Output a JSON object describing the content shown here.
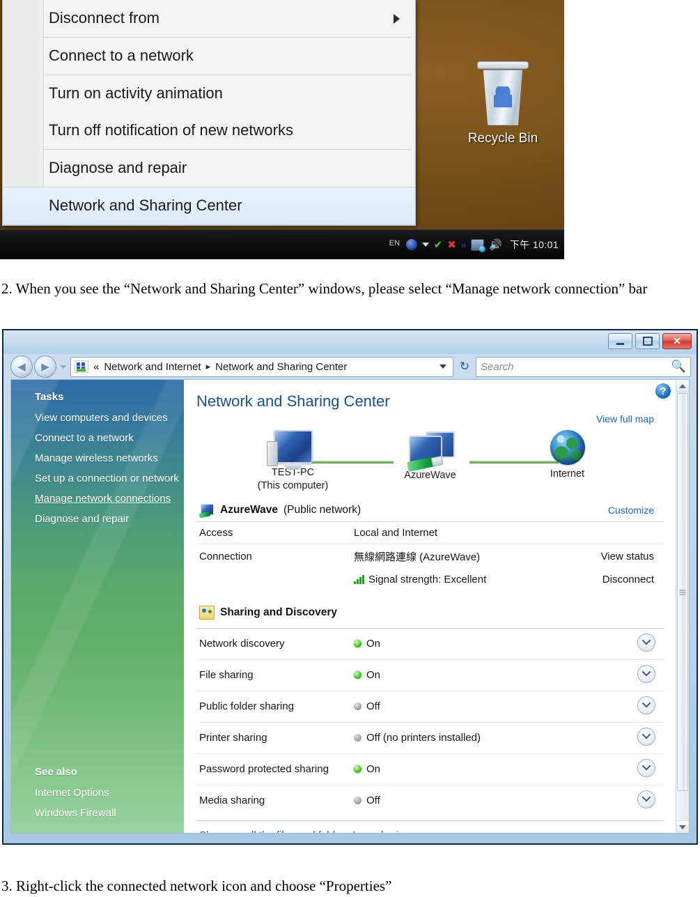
{
  "step1": {
    "context_menu": {
      "items": [
        {
          "label": "Disconnect from",
          "has_submenu": true,
          "highlighted": false
        },
        {
          "label": "Connect to a network",
          "has_submenu": false,
          "highlighted": false
        },
        {
          "label": "Turn on activity animation",
          "has_submenu": false,
          "highlighted": false
        },
        {
          "label": "Turn off notification of new networks",
          "has_submenu": false,
          "highlighted": false
        },
        {
          "label": "Diagnose and repair",
          "has_submenu": false,
          "highlighted": false
        },
        {
          "label": "Network and Sharing Center",
          "has_submenu": false,
          "highlighted": true
        }
      ]
    },
    "desktop": {
      "recycle_bin_label": "Recycle Bin"
    },
    "taskbar": {
      "language_indicator": "EN",
      "clock": "下午 10:01",
      "tray_icons": [
        "language-icon",
        "blue-orb-icon",
        "show-hidden-icons-icon",
        "green-check-icon",
        "red-shield-icon",
        "blue-wireless-icon",
        "network-icon",
        "volume-icon"
      ]
    }
  },
  "caption2": "2. When you see the “Network and Sharing Center” windows, please select “Manage network connection” bar",
  "caption3": "3. Right-click the connected network icon and choose “Properties”",
  "window": {
    "controls": {
      "minimize": "",
      "maximize": "",
      "close": "✕"
    },
    "address": {
      "icon": "network-icon",
      "overflow": "«",
      "crumbs": [
        "Network and Internet",
        "Network and Sharing Center"
      ],
      "separator": "▸"
    },
    "search": {
      "placeholder": "Search",
      "icon": "magnifier-icon"
    },
    "sidebar": {
      "tasks_heading": "Tasks",
      "tasks": [
        {
          "label": "View computers and devices",
          "active": false
        },
        {
          "label": "Connect to a network",
          "active": false
        },
        {
          "label": "Manage wireless networks",
          "active": false
        },
        {
          "label": "Set up a connection or network",
          "active": false
        },
        {
          "label": "Manage network connections",
          "active": true
        },
        {
          "label": "Diagnose and repair",
          "active": false
        }
      ],
      "see_also_heading": "See also",
      "see_also": [
        {
          "label": "Internet Options"
        },
        {
          "label": "Windows Firewall"
        }
      ]
    },
    "content": {
      "page_title": "Network and Sharing Center",
      "help_button": "?",
      "view_full_map": "View full map",
      "map": {
        "nodes": [
          {
            "name": "TEST-PC",
            "sub": "(This computer)",
            "icon": "computer-icon"
          },
          {
            "name": "AzureWave",
            "sub": "",
            "icon": "network-multi-computer-icon"
          },
          {
            "name": "Internet",
            "sub": "",
            "icon": "globe-icon"
          }
        ]
      },
      "network_section": {
        "icon": "network-connection-icon",
        "name": "AzureWave",
        "type": "(Public network)",
        "customize_link": "Customize",
        "rows": [
          {
            "label": "Access",
            "value": "Local and Internet",
            "action": ""
          },
          {
            "label": "Connection",
            "value": "無線網路連線 (AzureWave)",
            "action": "View status"
          },
          {
            "label": "",
            "value": "Signal strength:  Excellent",
            "action": "Disconnect",
            "icon": "signal-strength-icon"
          }
        ]
      },
      "sharing_section": {
        "icon": "people-sharing-icon",
        "heading": "Sharing and Discovery",
        "rows": [
          {
            "label": "Network discovery",
            "state": "On",
            "value": "On"
          },
          {
            "label": "File sharing",
            "state": "On",
            "value": "On"
          },
          {
            "label": "Public folder sharing",
            "state": "Off",
            "value": "Off"
          },
          {
            "label": "Printer sharing",
            "state": "Off",
            "value": "Off (no printers installed)"
          },
          {
            "label": "Password protected sharing",
            "state": "On",
            "value": "On"
          },
          {
            "label": "Media sharing",
            "state": "Off",
            "value": "Off"
          }
        ],
        "expander_icon": "chevron-down-icon"
      },
      "bottom_link": "Show me all the files and folders I am sharing"
    }
  },
  "colors": {
    "accent_link": "#1f63b8",
    "title_blue": "#1a4f8a",
    "status_on": "#4fc62c",
    "status_off": "#a9a9a9",
    "sidebar_top": "#2f6ca6",
    "sidebar_bottom": "#9ad3a0",
    "close_button": "#cf3a32"
  }
}
